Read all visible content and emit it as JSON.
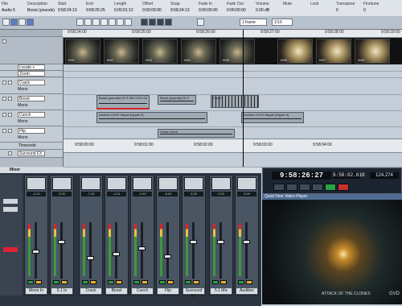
{
  "infobar": {
    "file": {
      "label": "File",
      "value": "Audio 5"
    },
    "description": {
      "label": "Description",
      "value": "Boost (pounds)"
    },
    "start": {
      "label": "Start",
      "value": "9:58:24:13"
    },
    "end": {
      "label": "End",
      "value": "9:58:25:25"
    },
    "length": {
      "label": "Length",
      "value": "0:00:01:12"
    },
    "offset": {
      "label": "Offset",
      "value": "0:00:00:00"
    },
    "snap": {
      "label": "Snap",
      "value": "9:58:24:13"
    },
    "fadein": {
      "label": "Fade In",
      "value": "0:00:00:00"
    },
    "fadeout": {
      "label": "Fade Out",
      "value": "0:00:00:00"
    },
    "volume": {
      "label": "Volume",
      "value": "0.00 dB"
    },
    "mute": {
      "label": "Mute",
      "value": ""
    },
    "lock": {
      "label": "Lock",
      "value": ""
    },
    "transpose": {
      "label": "Transpose",
      "value": "0"
    },
    "finetune": {
      "label": "Finetune",
      "value": "0"
    }
  },
  "toolbar": {
    "grid_select": "1 frame",
    "quantize_select": "1/16"
  },
  "ruler": {
    "ticks": [
      "9:58:24:00",
      "9:58:25:00",
      "9:58:26:00",
      "9:58:27:00",
      "9:58:28:00",
      "9:58:29:00"
    ]
  },
  "video_frames": [
    "1851",
    "1852",
    "1853",
    "1854",
    "1855",
    "1856",
    "1857",
    "1858"
  ],
  "tracks": [
    {
      "name": "Locate + Cycle",
      "sub": ""
    },
    {
      "name": "Zoom",
      "sub": ""
    },
    {
      "name": "Crack",
      "sub": "Mono"
    },
    {
      "name": "Boost",
      "sub": "Mono"
    },
    {
      "name": "Cunch",
      "sub": "Mono"
    },
    {
      "name": "Flip",
      "sub": "Mono"
    },
    {
      "name": "Timecode",
      "sub": ""
    },
    {
      "name": "Surround FX",
      "sub": ""
    }
  ],
  "clips": [
    {
      "label": "Boost (pounds) 02 S 00/1 00:2 00"
    },
    {
      "label": "Boost (pounds) 05 3"
    },
    {
      "label": "Cunch"
    },
    {
      "label": "Archive-XXXX Hippie (hippie 5)"
    },
    {
      "label": "Archive-XXXX Hippie (Hippie 5)"
    },
    {
      "label": "Guitar chord"
    }
  ],
  "timeline2": {
    "ticks": [
      "9:58:00:00",
      "9:58:01:00",
      "9:58:02:00",
      "9:58:03:00",
      "9:58:04:00"
    ]
  },
  "mixer": {
    "title": "Mixer",
    "channels": [
      {
        "name": "Mono In",
        "vol": "-3.12"
      },
      {
        "name": "5.1 In",
        "vol": "0.00"
      },
      {
        "name": "Crack",
        "vol": "-7.40"
      },
      {
        "name": "Boost",
        "vol": "-4.11"
      },
      {
        "name": "Cunch",
        "vol": "-2.00"
      },
      {
        "name": "Flip",
        "vol": "-5.62"
      },
      {
        "name": "Surround FX",
        "vol": "0.00"
      },
      {
        "name": "5.1 Mix",
        "vol": "0.00"
      },
      {
        "name": "Audition",
        "vol": "0.00"
      }
    ]
  },
  "transport": {
    "timecode": "9:58:26:27",
    "secondary": "9:58:02.610",
    "tempo": "124.274"
  },
  "video": {
    "title": "QuickTime Video Player",
    "caption": "ATTACK OF THE CLONES",
    "logo": "GVD"
  },
  "colors": {
    "accent": "#4f6c93",
    "play": "#2ba442",
    "record": "#c9302c",
    "meter_green": "#3b9b3b"
  }
}
